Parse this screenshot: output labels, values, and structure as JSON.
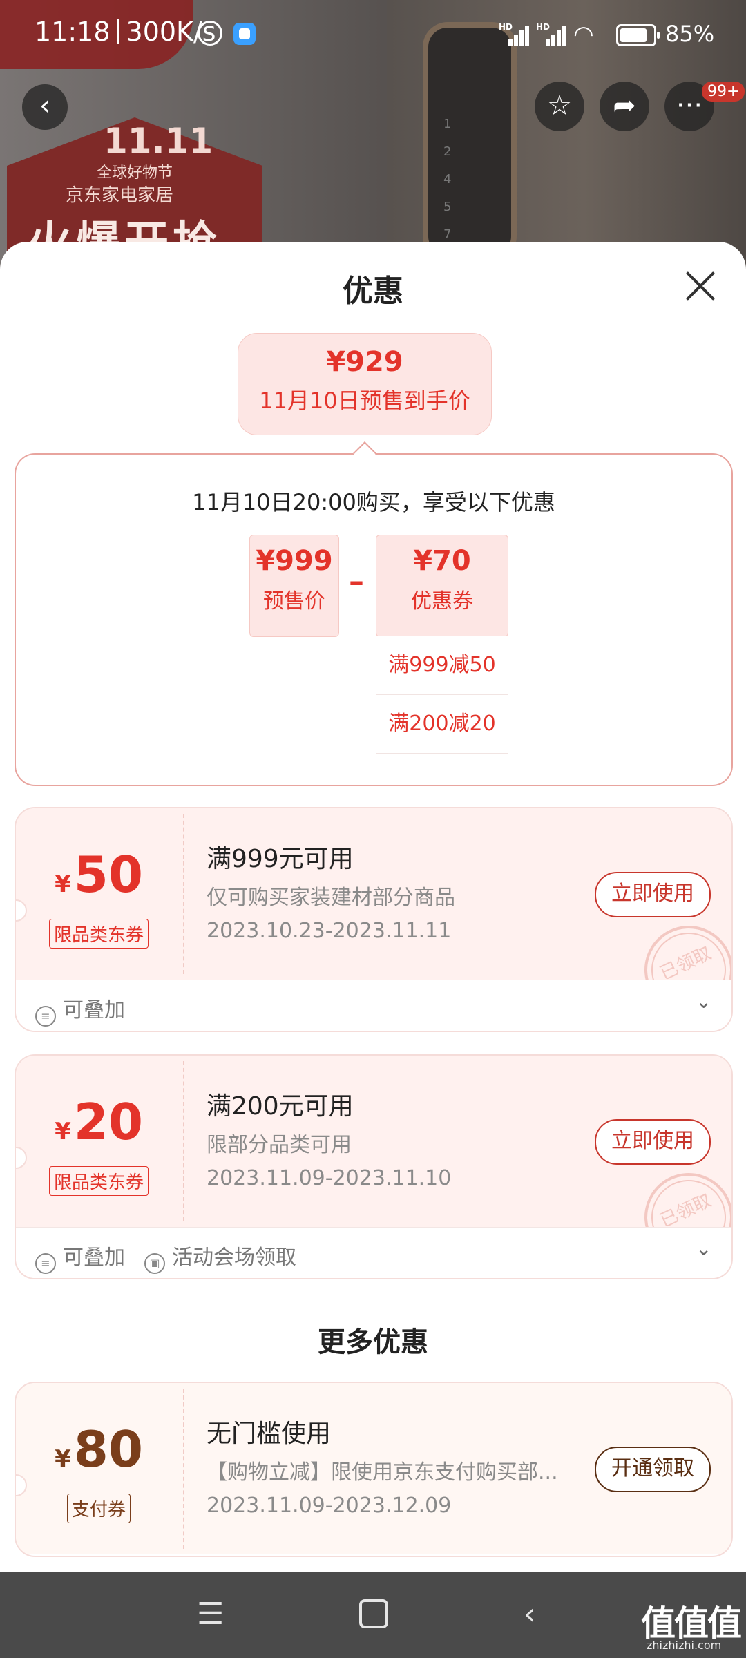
{
  "status_bar": {
    "time": "11:18",
    "speed": "300K/s",
    "battery": "85%"
  },
  "nav": {
    "badge": "99+"
  },
  "sheet": {
    "title": "优惠",
    "final_price": {
      "value": "¥929",
      "label": "11月10日预售到手价"
    },
    "calc": {
      "header": "11月10日20:00购买，享受以下优惠",
      "presale": {
        "value": "¥999",
        "label": "预售价"
      },
      "operator": "–",
      "coupon": {
        "value": "¥70",
        "label": "优惠券"
      },
      "coupon_items": [
        "满999减50",
        "满200减20"
      ]
    },
    "coupons": [
      {
        "symbol": "¥",
        "amount": "50",
        "tag": "限品类东券",
        "condition": "满999元可用",
        "desc": "仅可购买家装建材部分商品",
        "date": "2023.10.23-2023.11.11",
        "button": "立即使用",
        "stamp": "已领取",
        "foot": [
          "可叠加"
        ]
      },
      {
        "symbol": "¥",
        "amount": "20",
        "tag": "限品类东券",
        "condition": "满200元可用",
        "desc": "限部分品类可用",
        "date": "2023.11.09-2023.11.10",
        "button": "立即使用",
        "stamp": "已领取",
        "foot": [
          "可叠加",
          "活动会场领取"
        ]
      }
    ],
    "more_title": "更多优惠",
    "more": [
      {
        "symbol": "¥",
        "amount": "80",
        "tag": "支付券",
        "condition": "无门槛使用",
        "desc": "【购物立减】限使用京东支付购买部...",
        "date": "2023.11.09-2023.12.09",
        "button": "开通领取"
      }
    ]
  },
  "background": {
    "brand_1111": "11.11",
    "sub1": "全球好物节",
    "sub2": "京东家电家居",
    "headline": "火爆开抢"
  },
  "watermark": {
    "main": "值值值",
    "sub": "zhizhizhi.com"
  },
  "colors": {
    "accent": "#e3332a",
    "tan": "#7a3e1b",
    "card_bg": "#fff1ef"
  }
}
